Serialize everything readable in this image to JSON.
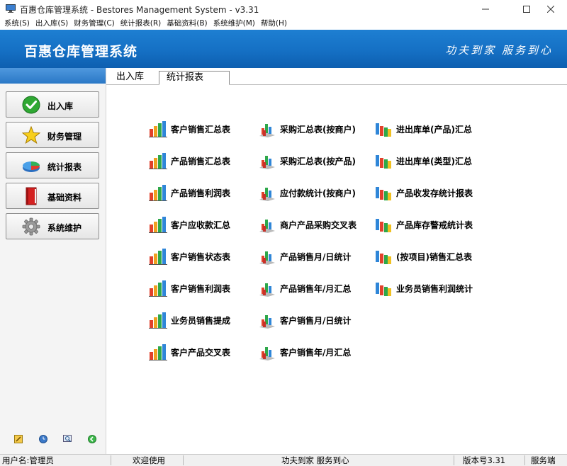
{
  "window": {
    "title": "百惠仓库管理系统 - Bestores Management System - v3.31",
    "app_icon": "monitor-icon",
    "controls": [
      "minimize-icon",
      "maximize-icon",
      "close-icon"
    ]
  },
  "menu": [
    "系统(S)",
    "出入库(S)",
    "财务管理(C)",
    "统计报表(R)",
    "基础资料(B)",
    "系统维护(M)",
    "帮助(H)"
  ],
  "banner": {
    "brand": "百惠仓库管理系统",
    "slogan": "功夫到家 服务到心",
    "color": "#1570c4"
  },
  "nav": [
    {
      "label": "出入库",
      "icon": "check-icon"
    },
    {
      "label": "财务管理",
      "icon": "star-icon"
    },
    {
      "label": "统计报表",
      "icon": "pie-chart-icon"
    },
    {
      "label": "基础资料",
      "icon": "book-icon"
    },
    {
      "label": "系统维护",
      "icon": "gear-icon"
    }
  ],
  "tools": [
    "edit-icon",
    "clock-icon",
    "search-icon",
    "back-icon"
  ],
  "tabs": [
    {
      "label": "出入库",
      "active": false
    },
    {
      "label": "统计报表",
      "active": true,
      "close": "×"
    }
  ],
  "reports": {
    "col1": [
      "客户销售汇总表",
      "产品销售汇总表",
      "产品销售利润表",
      "客户应收款汇总",
      "客户销售状态表",
      "客户销售利润表",
      "业务员销售提成",
      "客户产品交叉表"
    ],
    "col2": [
      "采购汇总表(按商户)",
      "采购汇总表(按产品)",
      "应付款统计(按商户)",
      "商户产品采购交叉表",
      "产品销售月/日统计",
      "产品销售年/月汇总",
      "客户销售月/日统计",
      "客户销售年/月汇总"
    ],
    "col3": [
      "进出库单(产品)汇总",
      "进出库单(类型)汇总",
      "产品收发存统计报表",
      "产品库存警戒统计表",
      "(按项目)销售汇总表",
      "业务员销售利润统计"
    ]
  },
  "status": {
    "user": "用户名:管理员",
    "welcome": "欢迎使用",
    "slogan": "功夫到家 服务到心",
    "version": "版本号3.31",
    "mode": "服务端"
  }
}
